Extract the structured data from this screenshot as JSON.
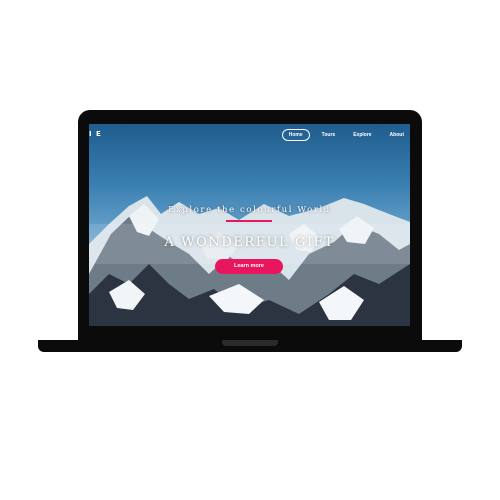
{
  "nav": {
    "logo": "I E",
    "links": [
      "Home",
      "Tours",
      "Explore",
      "About"
    ],
    "active": "Home"
  },
  "hero": {
    "subtitle": "Explore the colourful World",
    "title": "A WONDERFUL GIFT",
    "button": "Learn more"
  },
  "colors": {
    "accent": "#e8175d",
    "device": "#0b0b0b",
    "sky": "#3a7fb1"
  }
}
